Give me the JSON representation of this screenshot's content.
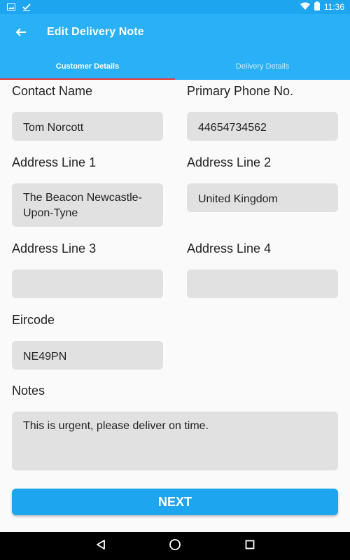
{
  "status_bar": {
    "time": "11:36",
    "icons": [
      "image-icon",
      "check-icon",
      "wifi-icon",
      "battery-icon"
    ]
  },
  "app_bar": {
    "title": "Edit Delivery Note",
    "back_icon": "arrow-back-icon"
  },
  "tabs": [
    {
      "label": "Customer Details",
      "selected": true
    },
    {
      "label": "Delivery Details",
      "selected": false
    }
  ],
  "form": {
    "contact_name": {
      "label": "Contact Name",
      "value": "Tom Norcott"
    },
    "primary_phone": {
      "label": "Primary Phone No.",
      "value": "44654734562"
    },
    "address_line_1": {
      "label": "Address Line 1",
      "value": "The Beacon Newcastle-Upon-Tyne"
    },
    "address_line_2": {
      "label": "Address Line 2",
      "value": "United Kingdom"
    },
    "address_line_3": {
      "label": "Address Line 3",
      "value": ""
    },
    "address_line_4": {
      "label": "Address Line 4",
      "value": ""
    },
    "eircode": {
      "label": "Eircode",
      "value": "NE49PN"
    },
    "notes": {
      "label": "Notes",
      "value": "This is urgent, please deliver on time."
    }
  },
  "next_button": {
    "label": "NEXT"
  },
  "nav_bar": {
    "icons": [
      "back-triangle-icon",
      "home-circle-icon",
      "recents-square-icon"
    ]
  },
  "colors": {
    "primary": "#29B0F6",
    "status_bar": "#1EA5F0",
    "tab_indicator": "#E53935",
    "field_background": "#E1E1E1",
    "button": "#1EA5F0"
  }
}
